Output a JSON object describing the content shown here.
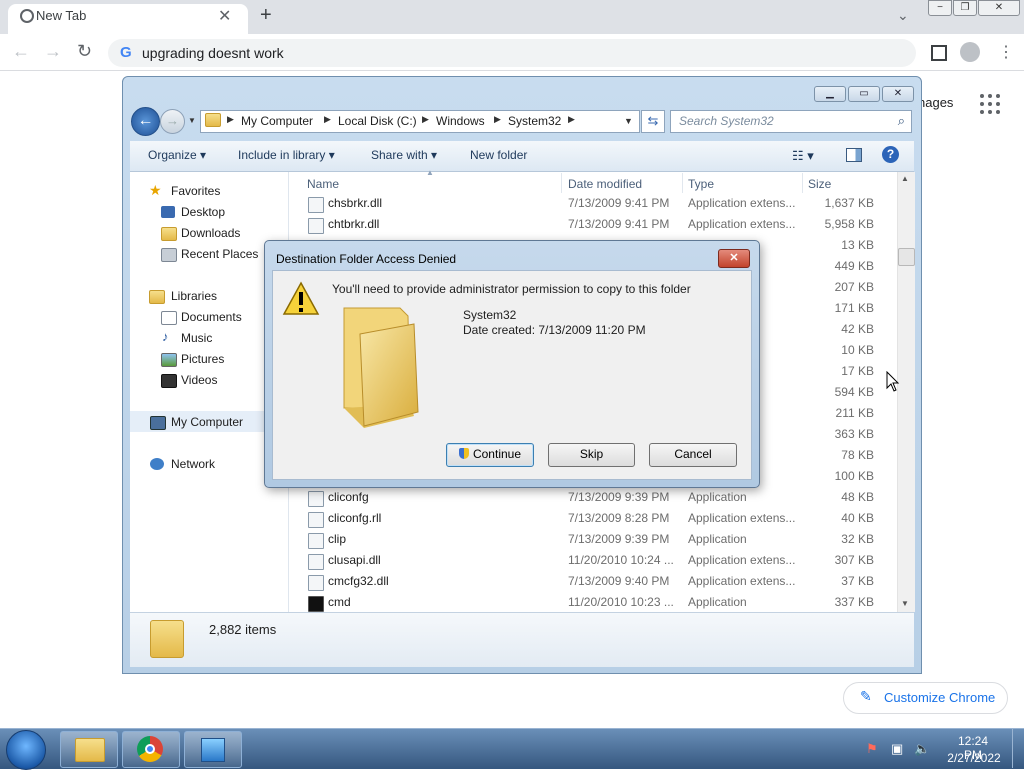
{
  "browser": {
    "tab_title": "New Tab",
    "new_tab": "+",
    "address": "upgrading doesnt work",
    "images_link": "nages",
    "customize_label": "Customize Chrome",
    "window_controls": [
      "−",
      "❐",
      "✕"
    ]
  },
  "explorer": {
    "breadcrumbs": [
      "My Computer",
      "Local Disk (C:)",
      "Windows",
      "System32"
    ],
    "search_placeholder": "Search System32",
    "commands": {
      "organize": "Organize ▾",
      "include": "Include in library ▾",
      "share": "Share with ▾",
      "new_folder": "New folder"
    },
    "nav": {
      "favorites": "Favorites",
      "desktop": "Desktop",
      "downloads": "Downloads",
      "recent": "Recent Places",
      "libraries": "Libraries",
      "documents": "Documents",
      "music": "Music",
      "pictures": "Pictures",
      "videos": "Videos",
      "my_computer": "My Computer",
      "network": "Network"
    },
    "columns": {
      "name": "Name",
      "date": "Date modified",
      "type": "Type",
      "size": "Size"
    },
    "files": [
      {
        "name": "chsbrkr.dll",
        "date": "7/13/2009 9:41 PM",
        "type": "Application extens...",
        "size": "1,637 KB"
      },
      {
        "name": "chtbrkr.dll",
        "date": "7/13/2009 9:41 PM",
        "type": "Application extens...",
        "size": "5,958 KB"
      },
      {
        "name": "",
        "date": "",
        "type": "extens...",
        "size": "13 KB"
      },
      {
        "name": "",
        "date": "",
        "type": "extens...",
        "size": "449 KB"
      },
      {
        "name": "",
        "date": "",
        "type": "extens...",
        "size": "207 KB"
      },
      {
        "name": "",
        "date": "",
        "type": "",
        "size": "171 KB"
      },
      {
        "name": "",
        "date": "",
        "type": "",
        "size": "42 KB"
      },
      {
        "name": "",
        "date": "",
        "type": "extens...",
        "size": "10 KB"
      },
      {
        "name": "",
        "date": "",
        "type": "extens...",
        "size": "17 KB"
      },
      {
        "name": "",
        "date": "",
        "type": "extens...",
        "size": "594 KB"
      },
      {
        "name": "",
        "date": "",
        "type": "",
        "size": "211 KB"
      },
      {
        "name": "",
        "date": "",
        "type": "",
        "size": "363 KB"
      },
      {
        "name": "",
        "date": "",
        "type": "extens...",
        "size": "78 KB"
      },
      {
        "name": "",
        "date": "",
        "type": "extens...",
        "size": "100 KB"
      },
      {
        "name": "cliconfg",
        "date": "7/13/2009 9:39 PM",
        "type": "Application",
        "size": "48 KB"
      },
      {
        "name": "cliconfg.rll",
        "date": "7/13/2009 8:28 PM",
        "type": "Application extens...",
        "size": "40 KB"
      },
      {
        "name": "clip",
        "date": "7/13/2009 9:39 PM",
        "type": "Application",
        "size": "32 KB"
      },
      {
        "name": "clusapi.dll",
        "date": "11/20/2010 10:24 ...",
        "type": "Application extens...",
        "size": "307 KB"
      },
      {
        "name": "cmcfg32.dll",
        "date": "7/13/2009 9:40 PM",
        "type": "Application extens...",
        "size": "37 KB"
      },
      {
        "name": "cmd",
        "date": "11/20/2010 10:23 ...",
        "type": "Application",
        "size": "337 KB"
      }
    ],
    "item_count": "2,882 items"
  },
  "dialog": {
    "title": "Destination Folder Access Denied",
    "message": "You'll need to provide administrator permission to copy to this folder",
    "folder_name": "System32",
    "date_created": "Date created: 7/13/2009 11:20 PM",
    "continue": "Continue",
    "skip": "Skip",
    "cancel": "Cancel",
    "close": "✕"
  },
  "taskbar": {
    "time": "12:24 PM",
    "date": "2/27/2022"
  }
}
